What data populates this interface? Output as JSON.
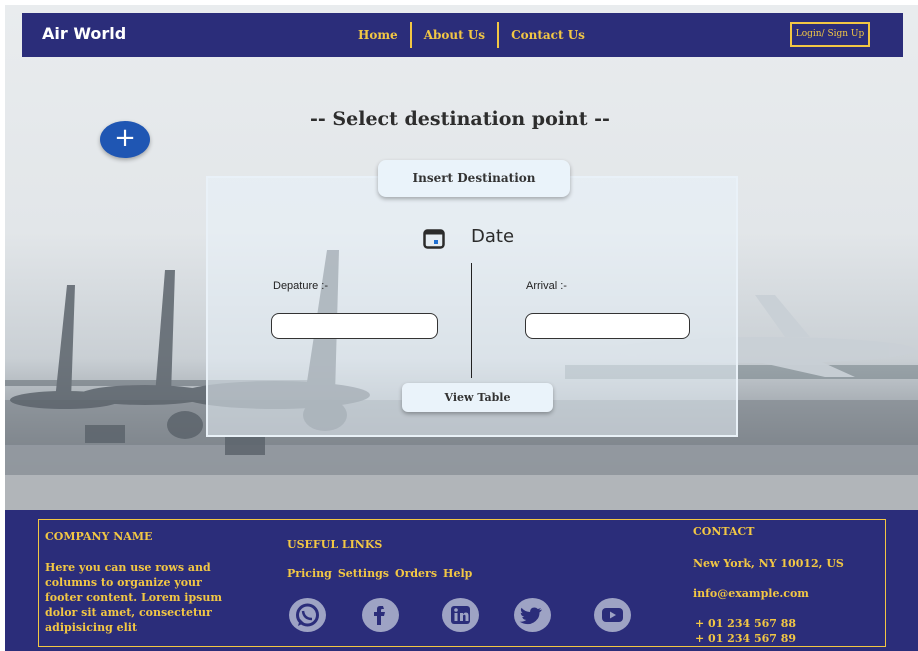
{
  "navbar": {
    "brand": "Air World",
    "links": [
      "Home",
      "About Us",
      "Contact Us"
    ],
    "login": "Login/ Sign Up"
  },
  "hero": {
    "add_button": "+",
    "title": "-- Select destination point --",
    "insert_destination": "Insert Destination",
    "date_label": "Date",
    "departure_label": "Depature :-",
    "departure_value": "",
    "arrival_label": "Arrival :-",
    "arrival_value": "",
    "view_table": "View Table"
  },
  "footer": {
    "company_title": "COMPANY NAME",
    "company_desc": "Here you can use rows and columns to organize your footer content. Lorem ipsum dolor sit amet, consectetur adipisicing elit",
    "links_title": "USEFUL LINKS",
    "links": [
      "Pricing",
      "Settings",
      "Orders",
      "Help"
    ],
    "contact_title": "CONTACT",
    "address": "New York, NY 10012, US",
    "email": "info@example.com",
    "phone1": "+ 01 234 567 88",
    "phone2": "+ 01 234 567 89",
    "social_icons": [
      "whatsapp-icon",
      "facebook-icon",
      "linkedin-icon",
      "twitter-icon",
      "youtube-icon"
    ]
  },
  "colors": {
    "navy": "#2b2d7a",
    "gold": "#f2c744",
    "fab_blue": "#1f56b3"
  }
}
